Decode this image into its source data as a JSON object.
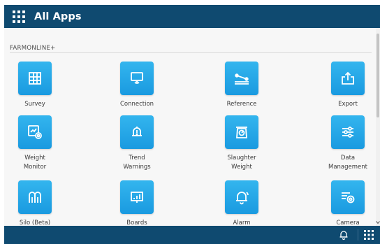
{
  "header": {
    "title": "All Apps",
    "menu_icon": "grid-menu-icon"
  },
  "section": {
    "label": "FARMONLINE+"
  },
  "apps": [
    {
      "label": [
        "Survey"
      ],
      "icon": "table-grid-icon"
    },
    {
      "label": [
        "Connection"
      ],
      "icon": "monitor-signal-icon"
    },
    {
      "label": [
        "Reference"
      ],
      "icon": "reference-line-icon"
    },
    {
      "label": [
        "Export"
      ],
      "icon": "export-tray-icon"
    },
    {
      "label": [
        "Weight",
        "Monitor"
      ],
      "icon": "weight-monitor-icon"
    },
    {
      "label": [
        "Trend",
        "Warnings"
      ],
      "icon": "bell-warning-icon"
    },
    {
      "label": [
        "Slaughter",
        "Weight"
      ],
      "icon": "scale-icon"
    },
    {
      "label": [
        "Data",
        "Management"
      ],
      "icon": "sliders-icon"
    },
    {
      "label": [
        "Silo (Beta)"
      ],
      "icon": "silo-icon"
    },
    {
      "label": [
        "Boards"
      ],
      "icon": "board-chart-icon"
    },
    {
      "label": [
        "Alarm"
      ],
      "icon": "alarm-bell-icon"
    },
    {
      "label": [
        "Camera"
      ],
      "icon": "camera-settings-icon"
    }
  ],
  "bottom_bar": {
    "notification_icon": "notification-bell-icon",
    "apps_icon": "apps-grid-icon"
  },
  "colors": {
    "header": "#0f4a70",
    "tile": "#23a6e8",
    "content_bg": "#f7f7f7"
  }
}
